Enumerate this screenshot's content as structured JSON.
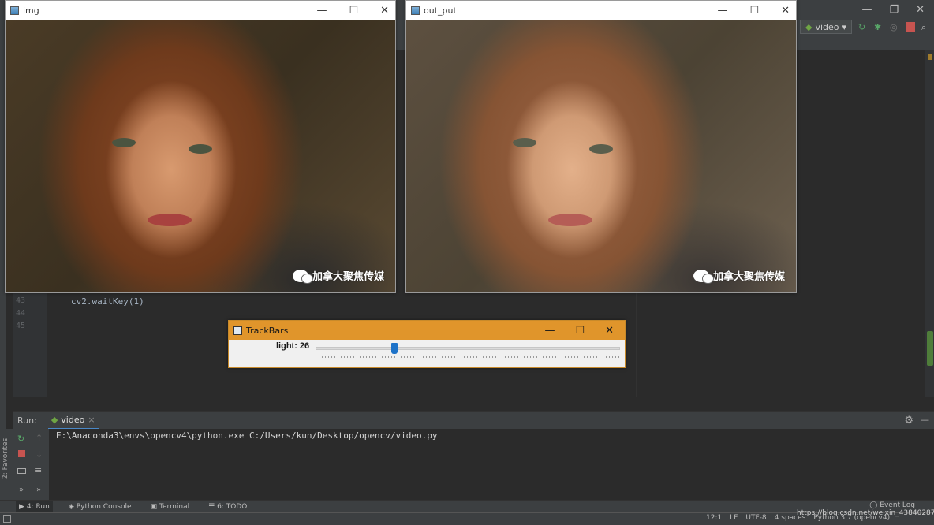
{
  "ide": {
    "window_controls": [
      "—",
      "❐",
      "✕"
    ],
    "run_config": "video",
    "gutter_lines": [
      "43",
      "44",
      "45"
    ],
    "code_line": "cv2.waitKey(1)",
    "run_panel": {
      "label": "Run:",
      "tab": "video",
      "command": "E:\\Anaconda3\\envs\\opencv4\\python.exe C:/Users/kun/Desktop/opencv/video.py"
    },
    "favorites_label": "2: Favorites",
    "bottom_tabs": [
      "4: Run",
      "Python Console",
      "Terminal",
      "6: TODO"
    ],
    "event_log": "Event Log",
    "status": [
      "12:1",
      "LF",
      "UTF-8",
      "4 spaces",
      "Python 3.7 (opencv4)"
    ],
    "watermark_url": "https://blog.csdn.net/weixin_43840287"
  },
  "windows": {
    "img": {
      "title": "img",
      "watermark": "加拿大聚焦传媒"
    },
    "out_put": {
      "title": "out_put",
      "watermark": "加拿大聚焦传媒"
    },
    "trackbars": {
      "title": "TrackBars",
      "slider_label": "light: 26",
      "slider_value": 26,
      "slider_max": 100
    }
  },
  "colors": {
    "trackbar_title": "#e0952b",
    "slider_thumb": "#1e73c9",
    "ide_bg": "#2b2b2b",
    "ide_chrome": "#3c3f41"
  }
}
